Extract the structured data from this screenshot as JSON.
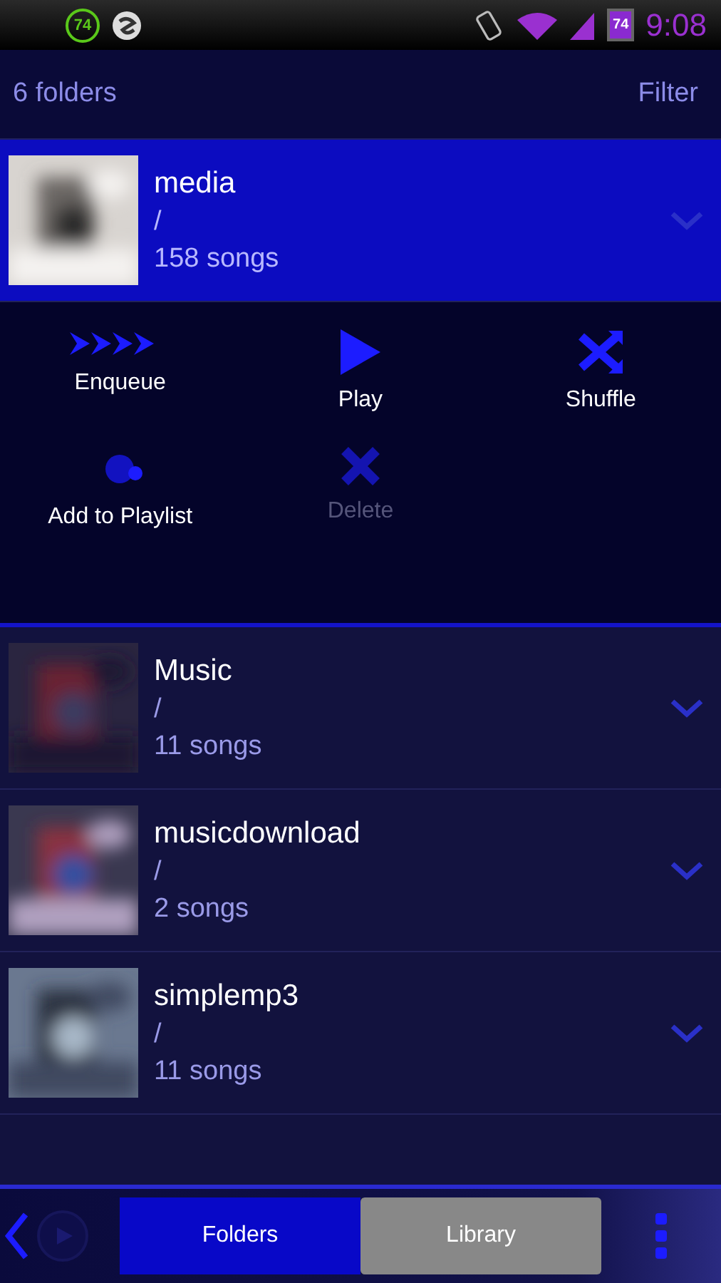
{
  "status_bar": {
    "notification_badge": "74",
    "battery_label": "74",
    "time": "9:08"
  },
  "header": {
    "count": "6 folders",
    "filter": "Filter"
  },
  "folders": [
    {
      "name": "media",
      "path": "/",
      "count": "158 songs",
      "selected": true
    },
    {
      "name": "Music",
      "path": "/",
      "count": "11 songs",
      "selected": false
    },
    {
      "name": "musicdownload",
      "path": "/",
      "count": "2 songs",
      "selected": false
    },
    {
      "name": "simplemp3",
      "path": "/",
      "count": "11 songs",
      "selected": false
    }
  ],
  "actions": [
    {
      "kind": "enqueue",
      "label": "Enqueue",
      "disabled": false
    },
    {
      "kind": "play",
      "label": "Play",
      "disabled": false
    },
    {
      "kind": "shuffle",
      "label": "Shuffle",
      "disabled": false
    },
    {
      "kind": "playlist",
      "label": "Add to Playlist",
      "disabled": false
    },
    {
      "kind": "delete",
      "label": "Delete",
      "disabled": true
    }
  ],
  "tabs": [
    {
      "label": "Folders",
      "selected": true
    },
    {
      "label": "Library",
      "selected": false
    }
  ]
}
